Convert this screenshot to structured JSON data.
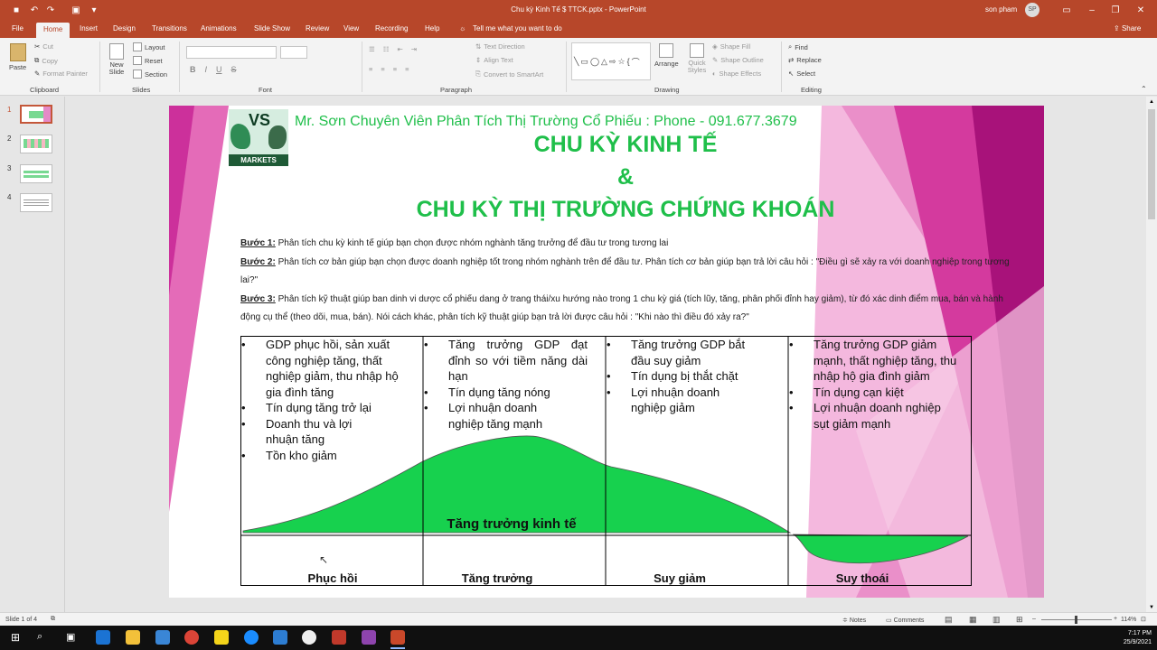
{
  "window": {
    "title": "Chu kỳ Kinh Tế $ TTCK.pptx  -  PowerPoint",
    "user": "son pham",
    "initials": "SP",
    "share": "Share"
  },
  "tabs": [
    "File",
    "Home",
    "Insert",
    "Design",
    "Transitions",
    "Animations",
    "Slide Show",
    "Review",
    "View",
    "Recording",
    "Help"
  ],
  "tellme": "Tell me what you want to do",
  "ribbon": {
    "paste": "Paste",
    "cut": "Cut",
    "copy": "Copy",
    "format_painter": "Format Painter",
    "new_slide": "New Slide",
    "layout": "Layout",
    "reset": "Reset",
    "section": "Section",
    "text_direction": "Text Direction",
    "align_text": "Align Text",
    "convert_smartart": "Convert to SmartArt",
    "arrange": "Arrange",
    "quick_styles": "Quick Styles",
    "shape_fill": "Shape Fill",
    "shape_outline": "Shape Outline",
    "shape_effects": "Shape Effects",
    "find": "Find",
    "replace": "Replace",
    "select": "Select",
    "groups": {
      "clipboard": "Clipboard",
      "slides": "Slides",
      "font": "Font",
      "paragraph": "Paragraph",
      "drawing": "Drawing",
      "editing": "Editing"
    }
  },
  "slide_numbers": [
    "1",
    "2",
    "3",
    "4"
  ],
  "slide": {
    "header": "Mr. Sơn Chuyên Viên Phân Tích Thị Trường Cổ Phiếu : Phone - 091.677.3679",
    "logo_text": "VS",
    "logo_sub": "MARKETS",
    "title1": "CHU KỲ KINH TẾ",
    "title2": "&",
    "title3": "CHU KỲ THỊ TRƯỜNG CHỨNG KHOÁN",
    "steps": [
      {
        "label": "Bước 1:",
        "text": " Phân tích chu kỳ kinh tế giúp bạn chọn được nhóm nghành tăng trưởng để đầu tư trong tương lai"
      },
      {
        "label": "Bước 2:",
        "text": " Phân tích cơ bản giúp bạn chọn được doanh nghiệp tốt trong nhóm nghành trên để đầu tư. Phân tích cơ bản giúp bạn trả lời câu hỏi : \"Điều gì sẽ xảy ra với doanh nghiệp trong tương lai?\""
      },
      {
        "label": "Bước 3:",
        "text": " Phân tích kỹ thuật giúp ban dinh vi dược cổ phiếu dang ở trang thái/xu hướng nào trong 1 chu kỳ giá (tích lũy, tăng, phân phối đỉnh hay giảm), từ đó xác dinh điểm mua, bán và hành động cụ thể (theo dõi, mua, bán). Nói cách khác, phân tích kỹ thuật giúp bạn trả lời được câu hỏi : \"Khi nào thì điều đó xảy ra?\""
      }
    ],
    "columns": [
      [
        "GDP phục hồi, sản xuất công nghiệp tăng, thất nghiệp giảm, thu nhập hộ gia đình tăng",
        "Tín dụng tăng trở lại",
        "Doanh thu và lợi nhuận tăng",
        "Tồn kho giảm"
      ],
      [
        "Tăng trưởng GDP đạt đỉnh so với tiềm năng dài hạn",
        "Tín dụng tăng nóng",
        "Lợi nhuận doanh nghiệp tăng mạnh"
      ],
      [
        "Tăng trưởng GDP bắt đầu suy giảm",
        "Tín dụng bị thắt chặt",
        "Lợi nhuận doanh nghiệp giảm"
      ],
      [
        "Tăng trưởng GDP giảm mạnh, thất nghiệp tăng, thu nhập hộ gia đình giảm",
        "Tín dụng cạn kiệt",
        "Lợi nhuận doanh nghiệp sụt giảm mạnh"
      ]
    ],
    "curve_label": "Tăng trưởng kinh tế",
    "phases": [
      "Phục hồi",
      "Tăng trưởng",
      "Suy giảm",
      "Suy thoái"
    ]
  },
  "status": {
    "slide": "Slide 1 of 4",
    "notes": "Notes",
    "comments": "Comments",
    "zoom": "114%"
  },
  "clock": {
    "time": "7:17 PM",
    "date": "25/9/2021"
  },
  "colors": {
    "accent": "#b7472a",
    "title_green": "#1fbf4a",
    "curve_green": "#17d14e",
    "magenta": "#c2178f"
  }
}
